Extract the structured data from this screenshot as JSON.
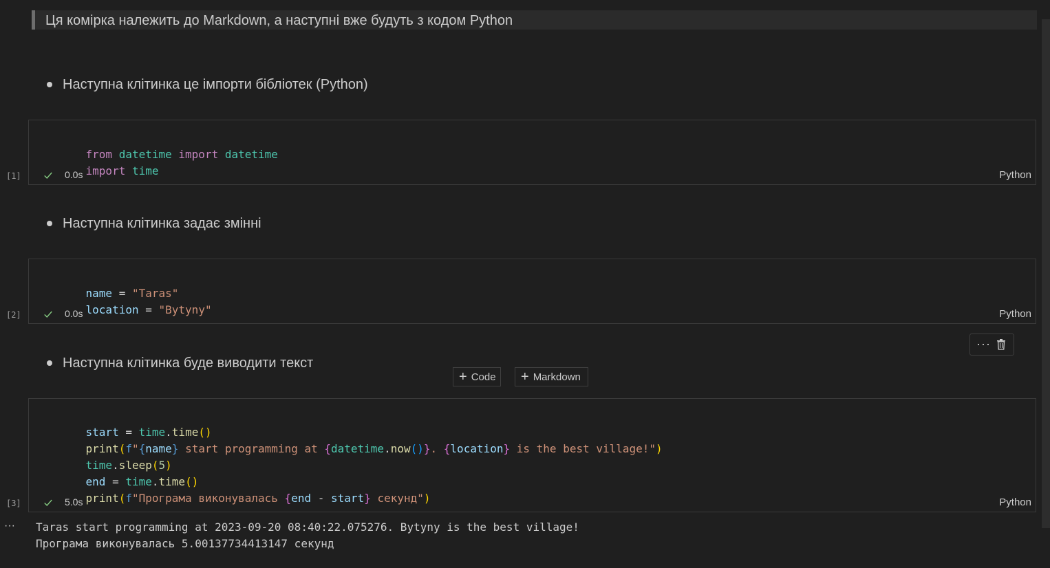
{
  "markdown_header": "Ця комірка належить до Markdown, а наступні вже будуть з кодом Python",
  "bullets": [
    "Наступна клітинка це імпорти бібліотек (Python)",
    "Наступна клітинка задає змінні",
    "Наступна клітинка буде виводити текст"
  ],
  "cells": [
    {
      "exec_count": "[1]",
      "status_time": "0.0s",
      "language": "Python",
      "lines": [
        "from datetime import datetime",
        "import time"
      ]
    },
    {
      "exec_count": "[2]",
      "status_time": "0.0s",
      "language": "Python",
      "lines": [
        "name = \"Taras\"",
        "location = \"Bytyny\""
      ]
    },
    {
      "exec_count": "[3]",
      "status_time": "5.0s",
      "language": "Python",
      "lines": [
        "start = time.time()",
        "print(f\"{name} start programming at {datetime.now()}. {location} is the best village!\")",
        "time.sleep(5)",
        "end = time.time()",
        "print(f\"Програма виконувалась {end - start} секунд\")"
      ]
    }
  ],
  "insert_toolbar": {
    "code_label": "Code",
    "markdown_label": "Markdown"
  },
  "cell_toolbar": {
    "more_icon": "ellipsis-icon",
    "delete_icon": "trash-icon"
  },
  "output": {
    "more_label": "···",
    "lines": [
      "Taras start programming at 2023-09-20 08:40:22.075276. Bytyny is the best village!",
      "Програма виконувалась 5.00137734413147 секунд"
    ]
  },
  "colors": {
    "background": "#1f1f1f",
    "keyword": "#c586c0",
    "module": "#4ec9b0",
    "variable": "#9cdcfe",
    "string": "#ce9178",
    "function": "#dcdcaa",
    "number": "#b5cea8",
    "success": "#89d185"
  }
}
